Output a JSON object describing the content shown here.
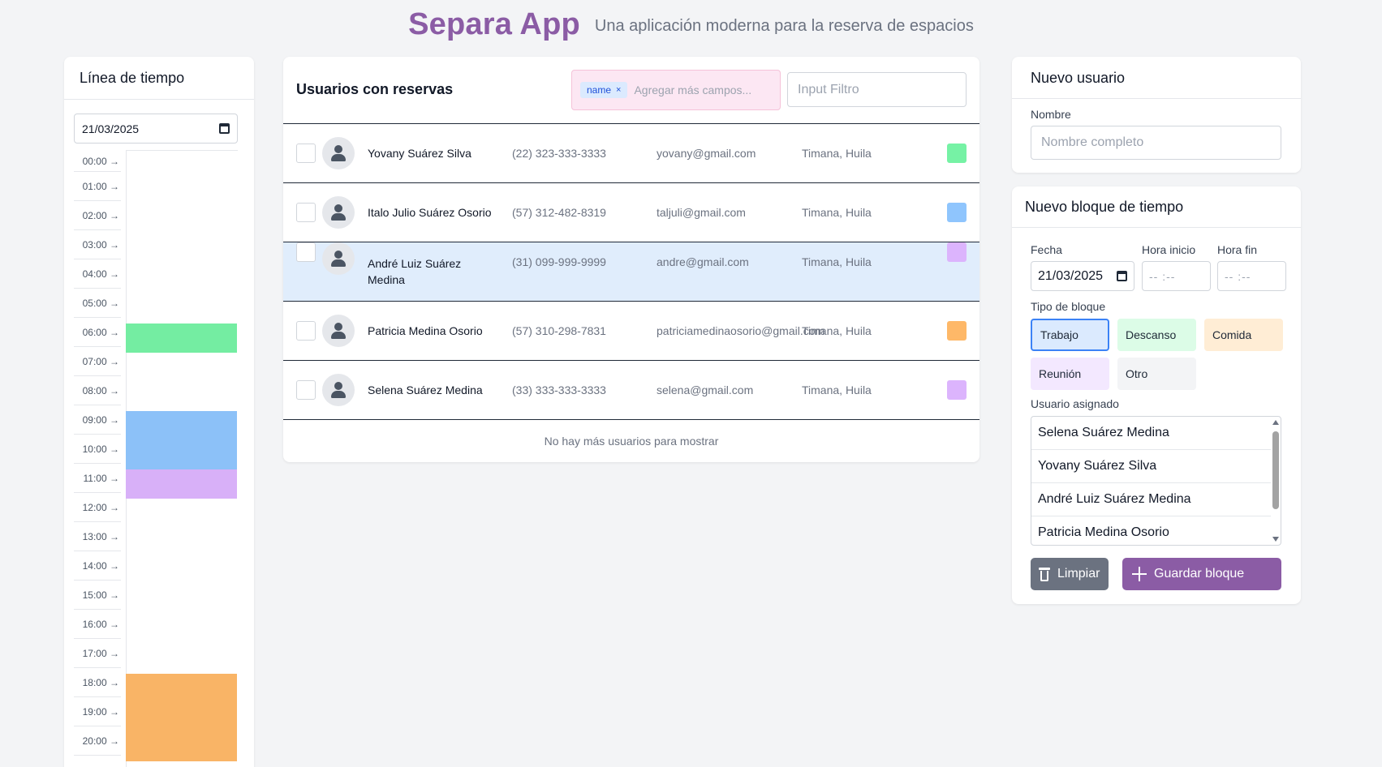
{
  "header": {
    "title": "Separa App",
    "subtitle": "Una aplicación moderna para la reserva de espacios"
  },
  "timeline": {
    "title": "Línea de tiempo",
    "date": "21/03/2025",
    "hours": [
      "00:00 →",
      "01:00 →",
      "02:00 →",
      "03:00 →",
      "04:00 →",
      "05:00 →",
      "06:00 →",
      "07:00 →",
      "08:00 →",
      "09:00 →",
      "10:00 →",
      "11:00 →",
      "12:00 →",
      "13:00 →",
      "14:00 →",
      "15:00 →",
      "16:00 →",
      "17:00 →",
      "18:00 →",
      "19:00 →",
      "20:00 →"
    ],
    "blocks": [
      {
        "start": "06:00",
        "end": "07:00",
        "color": "#76f2a5"
      },
      {
        "start": "09:00",
        "end": "11:00",
        "color": "#8fc5fd"
      },
      {
        "start": "11:00",
        "end": "12:00",
        "color": "#dcb4fd"
      },
      {
        "start": "18:00",
        "end": "21:00",
        "color": "#feb868"
      }
    ]
  },
  "users": {
    "title": "Usuarios con reservas",
    "tag": "name",
    "tag_remove": "×",
    "tags_placeholder": "Agregar más campos...",
    "filter_placeholder": "Input Filtro",
    "rows": [
      {
        "name": "Yovany Suárez Silva",
        "phone": "(22) 323-333-3333",
        "email": "yovany@gmail.com",
        "city": "Timana, Huila",
        "color": "#76f2a5"
      },
      {
        "name": "Italo Julio Suárez Osorio",
        "phone": "(57) 312-482-8319",
        "email": "taljuli@gmail.com",
        "city": "Timana, Huila",
        "color": "#8fc5fd"
      },
      {
        "name": "André Luiz Suárez Medina",
        "phone": "(31) 099-999-9999",
        "email": "andre@gmail.com",
        "city": "Timana, Huila",
        "color": "#dcb4fd"
      },
      {
        "name": "Patricia Medina Osorio",
        "phone": "(57) 310-298-7831",
        "email": "patriciamedinaosorio@gmail.com",
        "city": "Timana, Huila",
        "color": "#feb868"
      },
      {
        "name": "Selena Suárez Medina",
        "phone": "(33) 333-333-3333",
        "email": "selena@gmail.com",
        "city": "Timana, Huila",
        "color": "#dcb4fd"
      }
    ],
    "empty_message": "No hay más usuarios para mostrar"
  },
  "new_user": {
    "title": "Nuevo usuario",
    "name_label": "Nombre",
    "name_placeholder": "Nombre completo"
  },
  "new_block": {
    "title": "Nuevo bloque de tiempo",
    "date_label": "Fecha",
    "date_value": "21/03/2025",
    "start_label": "Hora inicio",
    "end_label": "Hora fin",
    "time_placeholder": "-- :--",
    "type_label": "Tipo de bloque",
    "types": [
      {
        "label": "Trabajo",
        "bg": "#dbeafe",
        "selected": true
      },
      {
        "label": "Descanso",
        "bg": "#dcfce7"
      },
      {
        "label": "Comida",
        "bg": "#ffedd5"
      },
      {
        "label": "Reunión",
        "bg": "#f3e8ff"
      },
      {
        "label": "Otro",
        "bg": "#f3f4f6"
      }
    ],
    "assigned_label": "Usuario asignado",
    "assigned_options": [
      "Selena Suárez Medina",
      "Yovany Suárez Silva",
      "André Luiz Suárez Medina",
      "Patricia Medina Osorio"
    ],
    "clear_label": "Limpiar",
    "save_label": "Guardar bloque"
  }
}
